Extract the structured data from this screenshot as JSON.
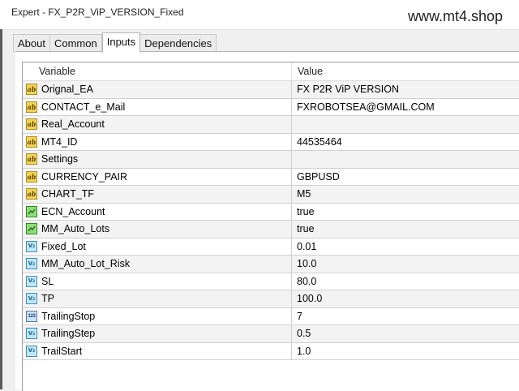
{
  "window": {
    "title": "Expert - FX_P2R_ViP_VERSION_Fixed",
    "watermark": "www.mt4.shop"
  },
  "tabs": [
    {
      "label": "About",
      "active": false
    },
    {
      "label": "Common",
      "active": false
    },
    {
      "label": "Inputs",
      "active": true
    },
    {
      "label": "Dependencies",
      "active": false
    }
  ],
  "table": {
    "headers": {
      "variable": "Variable",
      "value": "Value"
    },
    "rows": [
      {
        "name": "Orignal_EA",
        "value": "FX P2R ViP VERSION",
        "icon": "string-ab-icon",
        "type": "ab"
      },
      {
        "name": "CONTACT_e_Mail",
        "value": "FXROBOTSEA@GMAIL.COM",
        "icon": "string-ab-icon",
        "type": "ab"
      },
      {
        "name": "Real_Account",
        "value": "",
        "icon": "string-ab-icon",
        "type": "ab"
      },
      {
        "name": "MT4_ID",
        "value": "44535464",
        "icon": "string-ab-icon",
        "type": "ab"
      },
      {
        "name": "Settings",
        "value": "",
        "icon": "string-ab-icon",
        "type": "ab"
      },
      {
        "name": "CURRENCY_PAIR",
        "value": "GBPUSD",
        "icon": "string-ab-icon",
        "type": "ab"
      },
      {
        "name": "CHART_TF",
        "value": "M5",
        "icon": "string-ab-icon",
        "type": "ab"
      },
      {
        "name": "ECN_Account",
        "value": "true",
        "icon": "bool-icon",
        "type": "bool"
      },
      {
        "name": "MM_Auto_Lots",
        "value": "true",
        "icon": "bool-icon",
        "type": "bool"
      },
      {
        "name": "Fixed_Lot",
        "value": "0.01",
        "icon": "double-icon",
        "type": "dbl"
      },
      {
        "name": "MM_Auto_Lot_Risk",
        "value": "10.0",
        "icon": "double-icon",
        "type": "dbl"
      },
      {
        "name": "SL",
        "value": "80.0",
        "icon": "double-icon",
        "type": "dbl"
      },
      {
        "name": "TP",
        "value": "100.0",
        "icon": "double-icon",
        "type": "dbl"
      },
      {
        "name": "TrailingStop",
        "value": "7",
        "icon": "integer-icon",
        "type": "int"
      },
      {
        "name": "TrailingStep",
        "value": "0.5",
        "icon": "double-icon",
        "type": "dbl"
      },
      {
        "name": "TrailStart",
        "value": "1.0",
        "icon": "double-icon",
        "type": "dbl"
      }
    ]
  },
  "colors": {
    "row_alt": "#f3f3f3",
    "string_icon": "#f2d35a",
    "bool_icon": "#8fdc7a",
    "double_icon": "#bfe7f7"
  }
}
